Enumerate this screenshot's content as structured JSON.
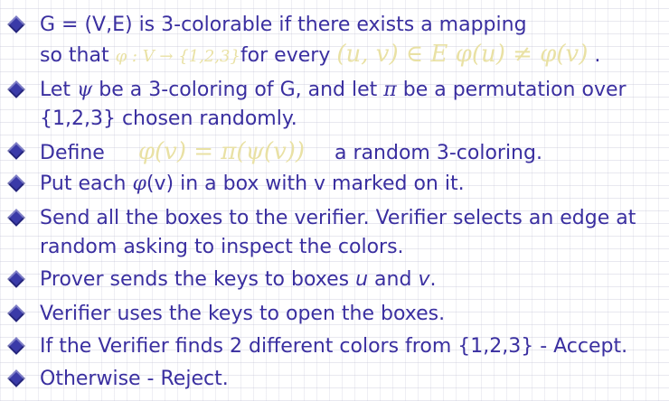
{
  "colors": {
    "text": "#3a2fa0",
    "bullet": "#3a3aa8",
    "math": "#e9e1a4"
  },
  "bullets": [
    {
      "line1": "G = (V,E) is 3-colorable if there exists a mapping",
      "so_that": "so that",
      "math_mapping": "φ : V → {1,2,3}",
      "for_every": "for every",
      "math_condition": "(u, v) ∈ E  φ(u) ≠ φ(v)",
      "period": "."
    },
    {
      "let": "Let",
      "psi": "ψ",
      "mid": "be a 3-coloring of G, and let",
      "pi": "π",
      "tail": "be a permutation over",
      "line2": "{1,2,3} chosen randomly."
    },
    {
      "define": "Define",
      "math_def": "φ(v) = π(ψ(v))",
      "tail": "a random 3-coloring."
    },
    {
      "put_each": "Put each",
      "phi": "φ",
      "tail": "(v) in a box with v marked on it."
    },
    {
      "line1": "Send all the boxes to the verifier. Verifier selects an edge at",
      "line2": "random asking to inspect the colors."
    },
    {
      "pre": "Prover sends the keys to boxes",
      "u": "u",
      "and": "and",
      "v": "v",
      "period": "."
    },
    {
      "text": "Verifier uses the keys to open the boxes."
    },
    {
      "text": "If the Verifier finds 2 different colors from {1,2,3} - Accept."
    },
    {
      "text": "Otherwise - Reject."
    }
  ]
}
